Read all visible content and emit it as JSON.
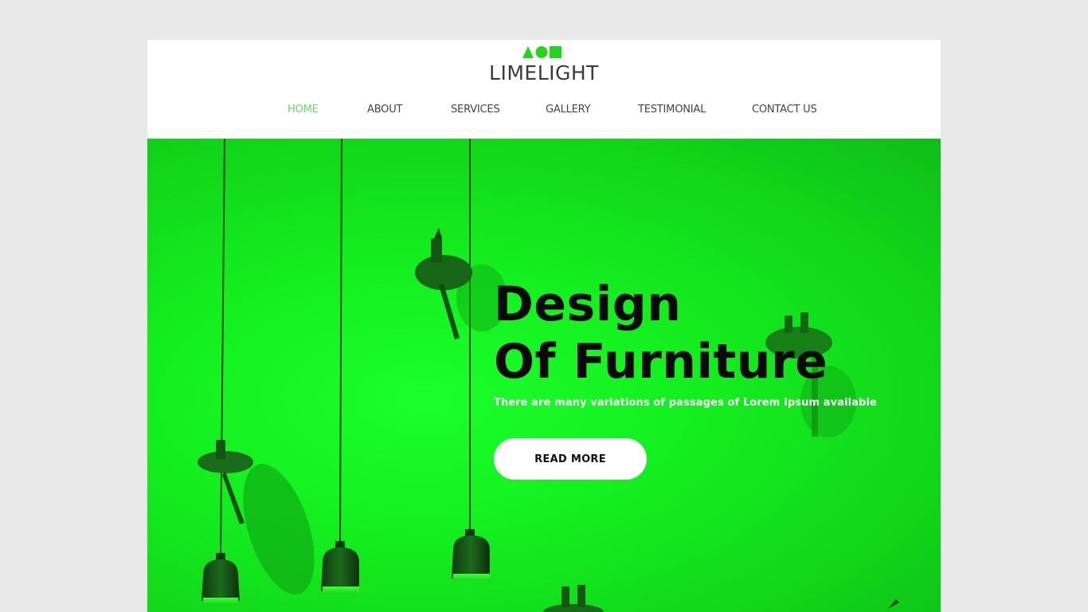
{
  "brand": {
    "name": "LIMELIGHT",
    "accent_color": "#6ed36a",
    "logo_icon": "triangle-circle-square-icon"
  },
  "nav": {
    "items": [
      {
        "label": "HOME",
        "active": true
      },
      {
        "label": "ABOUT",
        "active": false
      },
      {
        "label": "SERVICES",
        "active": false
      },
      {
        "label": "GALLERY",
        "active": false
      },
      {
        "label": "TESTIMONIAL",
        "active": false
      },
      {
        "label": "CONTACT US",
        "active": false
      }
    ]
  },
  "hero": {
    "title_line1": "Design",
    "title_line2": "Of Furniture",
    "subtitle": "There are many variations of passages of Lorem Ipsum available",
    "button_label": "READ MORE",
    "background_color": "#14f01f",
    "background_image": "pendant-lamps-image"
  }
}
